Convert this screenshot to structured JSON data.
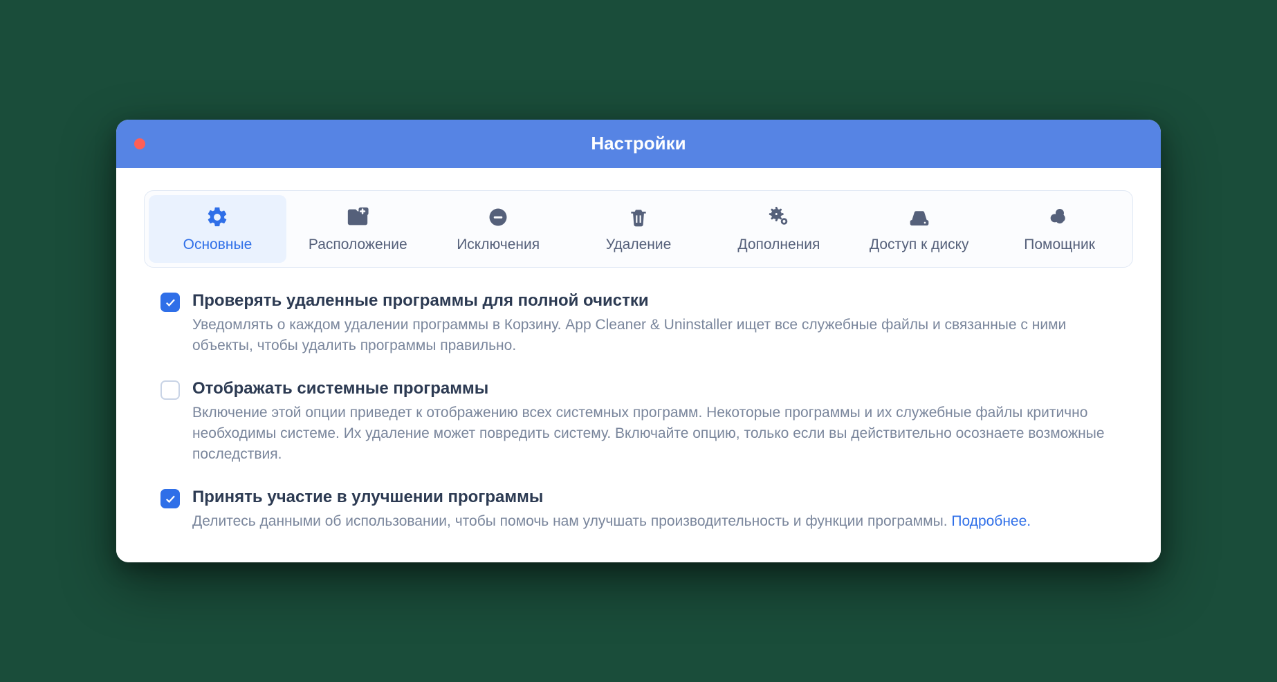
{
  "window": {
    "title": "Настройки"
  },
  "tabs": [
    {
      "label": "Основные",
      "icon": "gear-icon",
      "active": true
    },
    {
      "label": "Расположение",
      "icon": "folder-plus-icon",
      "active": false
    },
    {
      "label": "Исключения",
      "icon": "minus-circle-icon",
      "active": false
    },
    {
      "label": "Удаление",
      "icon": "trash-icon",
      "active": false
    },
    {
      "label": "Дополнения",
      "icon": "gears-icon",
      "active": false
    },
    {
      "label": "Доступ к диску",
      "icon": "disk-icon",
      "active": false
    },
    {
      "label": "Помощник",
      "icon": "helper-icon",
      "active": false
    }
  ],
  "options": [
    {
      "checked": true,
      "title": "Проверять удаленные программы для полной очистки",
      "description": "Уведомлять о каждом удалении программы в Корзину. App Cleaner & Uninstaller ищет все служебные файлы и связанные с ними объекты, чтобы удалить программы правильно."
    },
    {
      "checked": false,
      "title": "Отображать системные программы",
      "description": "Включение этой опции приведет к отображению всех системных программ. Некоторые программы и их служебные файлы критично необходимы системе. Их удаление может повредить систему. Включайте опцию, только если вы действительно осознаете возможные последствия."
    },
    {
      "checked": true,
      "title": "Принять участие в улучшении программы",
      "description": "Делитесь данными об использовании, чтобы помочь нам улучшать производительность и функции программы. ",
      "learn_more": "Подробнее."
    }
  ]
}
